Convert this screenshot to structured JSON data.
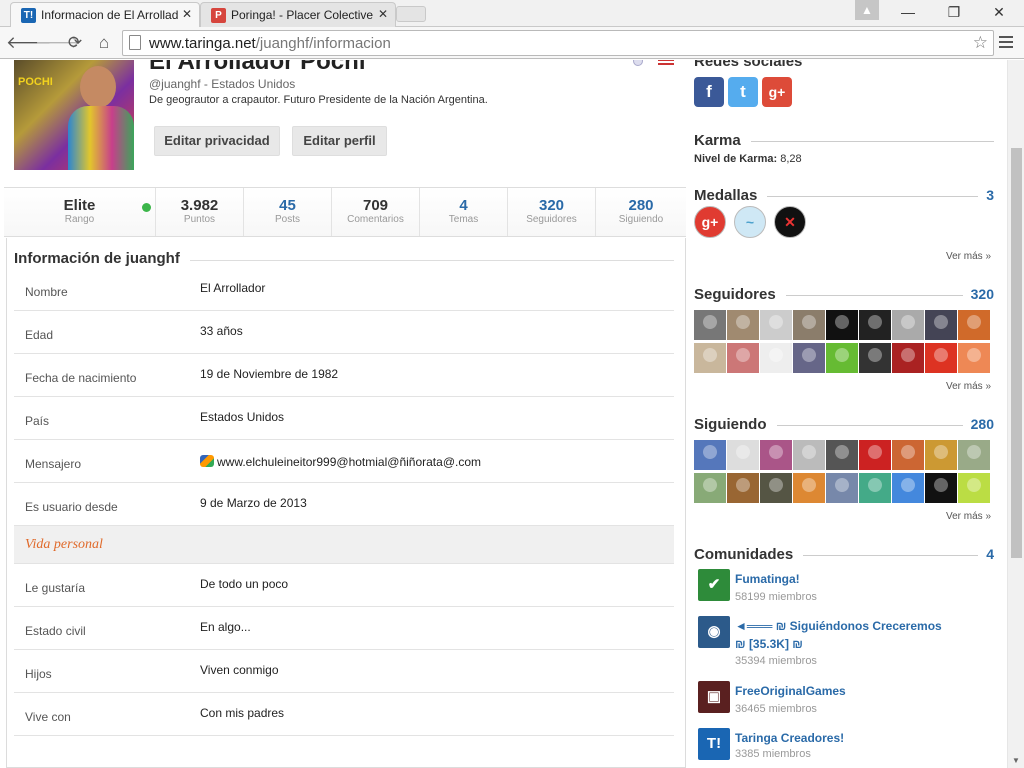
{
  "browser": {
    "tabs": [
      {
        "title": "Informacion de El Arrollad",
        "favicon": "T!",
        "color": "#1a66b3"
      },
      {
        "title": "Poringa! - Placer Colective",
        "favicon": "P",
        "color": "#d6453d"
      }
    ],
    "tab_close": "✕",
    "url_host": "www.taringa.net",
    "url_path": "/juanghf/informacion",
    "icons": {
      "back": "back-arrow-icon",
      "forward": "forward-arrow-icon",
      "reload": "reload-icon",
      "home": "home-icon",
      "star": "bookmark-star-icon",
      "menu": "menu-icon"
    },
    "glyphs": {
      "back": "🡐",
      "forward": "🡒",
      "reload": "⟳",
      "home": "⌂",
      "star": "☆",
      "minimize": "—",
      "maximize": "❐",
      "close": "✕",
      "user": "▲"
    }
  },
  "profile": {
    "name": "El Arrollador Pochi",
    "handle": "@juanghf - Estados Unidos",
    "description": "De geograutor a crapautor. Futuro Presidente de la Nación Argentina.",
    "avatar_text": "POCHI",
    "btn_privacy": "Editar privacidad",
    "btn_edit": "Editar perfil"
  },
  "stats": [
    {
      "value": "Elite",
      "label": "Rango"
    },
    {
      "value": "3.982",
      "label": "Puntos"
    },
    {
      "value": "45",
      "label": "Posts"
    },
    {
      "value": "709",
      "label": "Comentarios"
    },
    {
      "value": "4",
      "label": "Temas"
    },
    {
      "value": "320",
      "label": "Seguidores"
    },
    {
      "value": "280",
      "label": "Siguiendo"
    }
  ],
  "info": {
    "title": "Información de juanghf",
    "rows": [
      {
        "k": "Nombre",
        "v": "El Arrollador"
      },
      {
        "k": "Edad",
        "v": "33 años"
      },
      {
        "k": "Fecha de nacimiento",
        "v": "19 de Noviembre de 1982"
      },
      {
        "k": "País",
        "v": "Estados Unidos"
      },
      {
        "k": "Mensajero",
        "v": "www.elchuleineitor999@hotmial@ñiñorata@.com"
      },
      {
        "k": "Es usuario desde",
        "v": "9 de Marzo de 2013"
      }
    ],
    "personal_title": "Vida personal",
    "personal_rows": [
      {
        "k": "Le gustaría",
        "v": "De todo un poco"
      },
      {
        "k": "Estado civil",
        "v": "En algo..."
      },
      {
        "k": "Hijos",
        "v": "Viven conmigo"
      },
      {
        "k": "Vive con",
        "v": "Con mis padres"
      }
    ]
  },
  "sidebar": {
    "redes_title": "Redes sociales",
    "social": [
      {
        "icon": "facebook-icon",
        "glyph": "f",
        "color": "#3b5998"
      },
      {
        "icon": "twitter-icon",
        "glyph": "t",
        "color": "#55acee"
      },
      {
        "icon": "google-plus-icon",
        "glyph": "g+",
        "color": "#dd4b39"
      }
    ],
    "karma_title": "Karma",
    "karma_label": "Nivel de Karma:",
    "karma_value": "8,28",
    "medallas_title": "Medallas",
    "medallas_count": "3",
    "medals": [
      {
        "icon": "google-plus-medal-icon",
        "glyph": "g+",
        "bg": "#e03b31",
        "fg": "#fff"
      },
      {
        "icon": "bird-medal-icon",
        "glyph": "~",
        "bg": "#cfe8f5",
        "fg": "#4aa0cc"
      },
      {
        "icon": "x-medal-icon",
        "glyph": "✕",
        "bg": "#111",
        "fg": "#e33"
      }
    ],
    "ver_mas": "Ver más »",
    "seguidores_title": "Seguidores",
    "seguidores_count": "320",
    "seguidores_colors": [
      "#777",
      "#a08a70",
      "#ccc",
      "#8b7d6b",
      "#111",
      "#222",
      "#aaa",
      "#445",
      "#d06a2a",
      "#c9b79c",
      "#c77",
      "#eee",
      "#668",
      "#6b3",
      "#333",
      "#a22",
      "#d32",
      "#e85"
    ],
    "siguiendo_title": "Siguiendo",
    "siguiendo_count": "280",
    "siguiendo_colors": [
      "#57b",
      "#ddd",
      "#a58",
      "#bbb",
      "#555",
      "#c22",
      "#c63",
      "#c93",
      "#9a8",
      "#8a7",
      "#963",
      "#554",
      "#d83",
      "#78a",
      "#4a8",
      "#48d",
      "#111",
      "#bd4"
    ],
    "comunidades_title": "Comunidades",
    "comunidades_count": "4",
    "communities": [
      {
        "name": "Fumatinga!",
        "members": "58199 miembros",
        "icon": "leaf-icon",
        "glyph": "✔",
        "color": "#2e8b3a"
      },
      {
        "name": "◄═══ ₪ Siguiéndonos Creceremos ₪ [35.3K] ₪",
        "members": "35394 miembros",
        "icon": "globe-icon",
        "glyph": "◉",
        "color": "#2c5a8a"
      },
      {
        "name": "FreeOriginalGames",
        "members": "36465 miembros",
        "icon": "game-icon",
        "glyph": "▣",
        "color": "#5a2020"
      },
      {
        "name": "Taringa Creadores!",
        "members": "3385 miembros",
        "icon": "taringa-icon",
        "glyph": "T!",
        "color": "#1a66b3"
      }
    ]
  }
}
